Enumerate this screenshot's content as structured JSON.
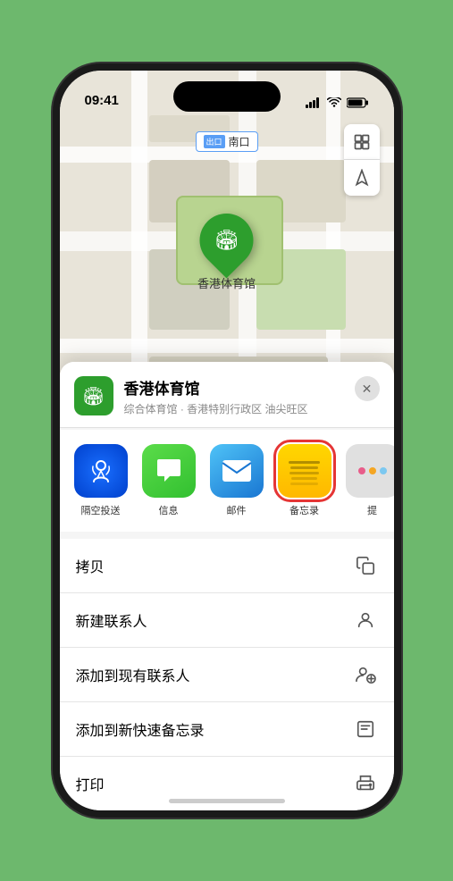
{
  "status_bar": {
    "time": "09:41",
    "location_arrow": "▶"
  },
  "map": {
    "label_prefix": "出口",
    "label_text": "南口"
  },
  "pin": {
    "label": "香港体育馆"
  },
  "venue": {
    "name": "香港体育馆",
    "subtitle": "综合体育馆 · 香港特别行政区 油尖旺区"
  },
  "share_apps": [
    {
      "id": "airdrop",
      "label": "隔空投送",
      "type": "airdrop"
    },
    {
      "id": "messages",
      "label": "信息",
      "type": "messages"
    },
    {
      "id": "mail",
      "label": "邮件",
      "type": "mail"
    },
    {
      "id": "notes",
      "label": "备忘录",
      "type": "notes",
      "highlighted": true
    },
    {
      "id": "more",
      "label": "提",
      "type": "more"
    }
  ],
  "actions": [
    {
      "id": "copy",
      "label": "拷贝",
      "icon": "copy"
    },
    {
      "id": "new-contact",
      "label": "新建联系人",
      "icon": "person"
    },
    {
      "id": "add-existing",
      "label": "添加到现有联系人",
      "icon": "person-add"
    },
    {
      "id": "add-notes",
      "label": "添加到新快速备忘录",
      "icon": "notes-add"
    },
    {
      "id": "print",
      "label": "打印",
      "icon": "print"
    }
  ]
}
